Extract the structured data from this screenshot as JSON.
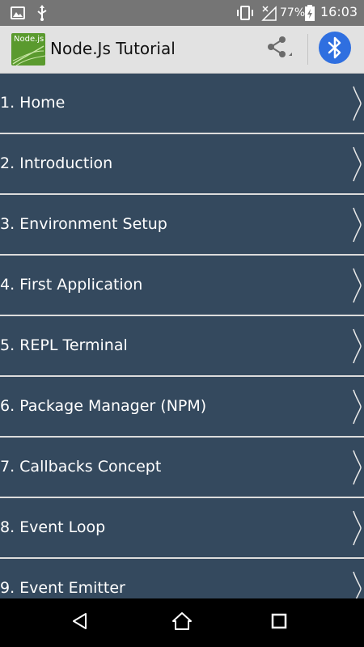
{
  "status_bar": {
    "battery_percent": "77%",
    "time": "16:03",
    "icons": [
      "image-icon",
      "usb-icon",
      "vibrate-icon",
      "no-signal-icon",
      "battery-charging-icon"
    ]
  },
  "action_bar": {
    "logo_text": "Node.js",
    "title": "Node.Js Tutorial",
    "share_icon": "share-icon",
    "bluetooth_icon": "bluetooth-icon",
    "colors": {
      "background": "#e2e2e2",
      "bluetooth_circle": "#2f6fe0",
      "logo_bg": "#5a9a2e"
    }
  },
  "menu": {
    "items": [
      {
        "label": "1. Home"
      },
      {
        "label": "2. Introduction"
      },
      {
        "label": "3. Environment Setup"
      },
      {
        "label": "4. First Application"
      },
      {
        "label": "5. REPL Terminal"
      },
      {
        "label": "6. Package Manager (NPM)"
      },
      {
        "label": "7. Callbacks Concept"
      },
      {
        "label": "8. Event Loop"
      },
      {
        "label": "9. Event Emitter"
      }
    ],
    "chevron_icon": "chevron-right-icon",
    "colors": {
      "item_bg": "#34495e",
      "divider": "#dcdcdc",
      "text": "#ffffff"
    }
  },
  "nav_bar": {
    "icons": [
      "back-icon",
      "home-icon",
      "recents-icon"
    ]
  }
}
